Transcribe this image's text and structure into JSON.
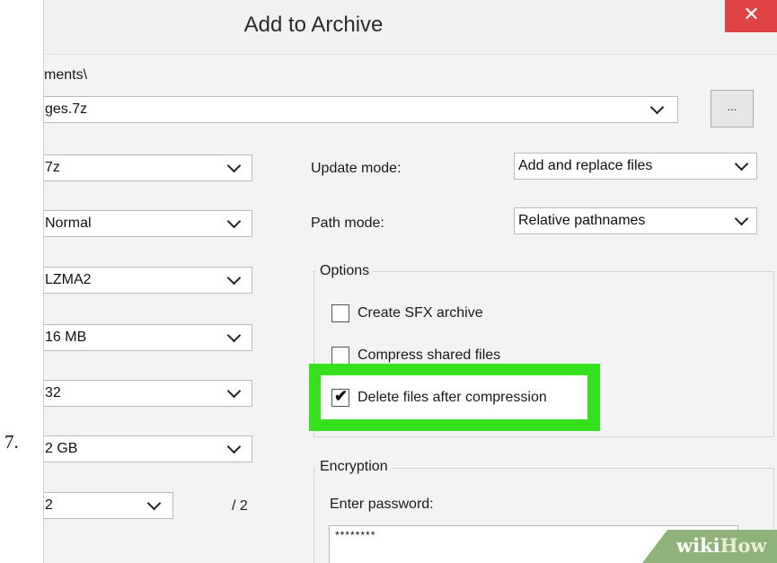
{
  "step_number": "7.",
  "window": {
    "title": "Add to Archive",
    "close_glyph": "✕",
    "path_label": "ments\\",
    "archive_name": "ges.7z",
    "browse_label": "..."
  },
  "left_combos": [
    {
      "value": "7z"
    },
    {
      "value": "Normal"
    },
    {
      "value": "LZMA2"
    },
    {
      "value": "16 MB"
    },
    {
      "value": "32"
    },
    {
      "value": "2 GB"
    },
    {
      "value": "2"
    }
  ],
  "threads_total": "/ 2",
  "right_panel": {
    "update_mode_label": "Update mode:",
    "update_mode_value": "Add and replace files",
    "path_mode_label": "Path mode:",
    "path_mode_value": "Relative pathnames",
    "options_title": "Options",
    "options": [
      {
        "label": "Create SFX archive",
        "checked": false
      },
      {
        "label": "Compress shared files",
        "checked": false
      },
      {
        "label": "Delete files after compression",
        "checked": true
      }
    ],
    "checkmark": "✔",
    "encryption_title": "Encryption",
    "enter_password_label": "Enter password:",
    "password_value": "********"
  },
  "highlight_color": "#35e01c",
  "watermark": {
    "part1": "wiki",
    "part2": "How"
  }
}
